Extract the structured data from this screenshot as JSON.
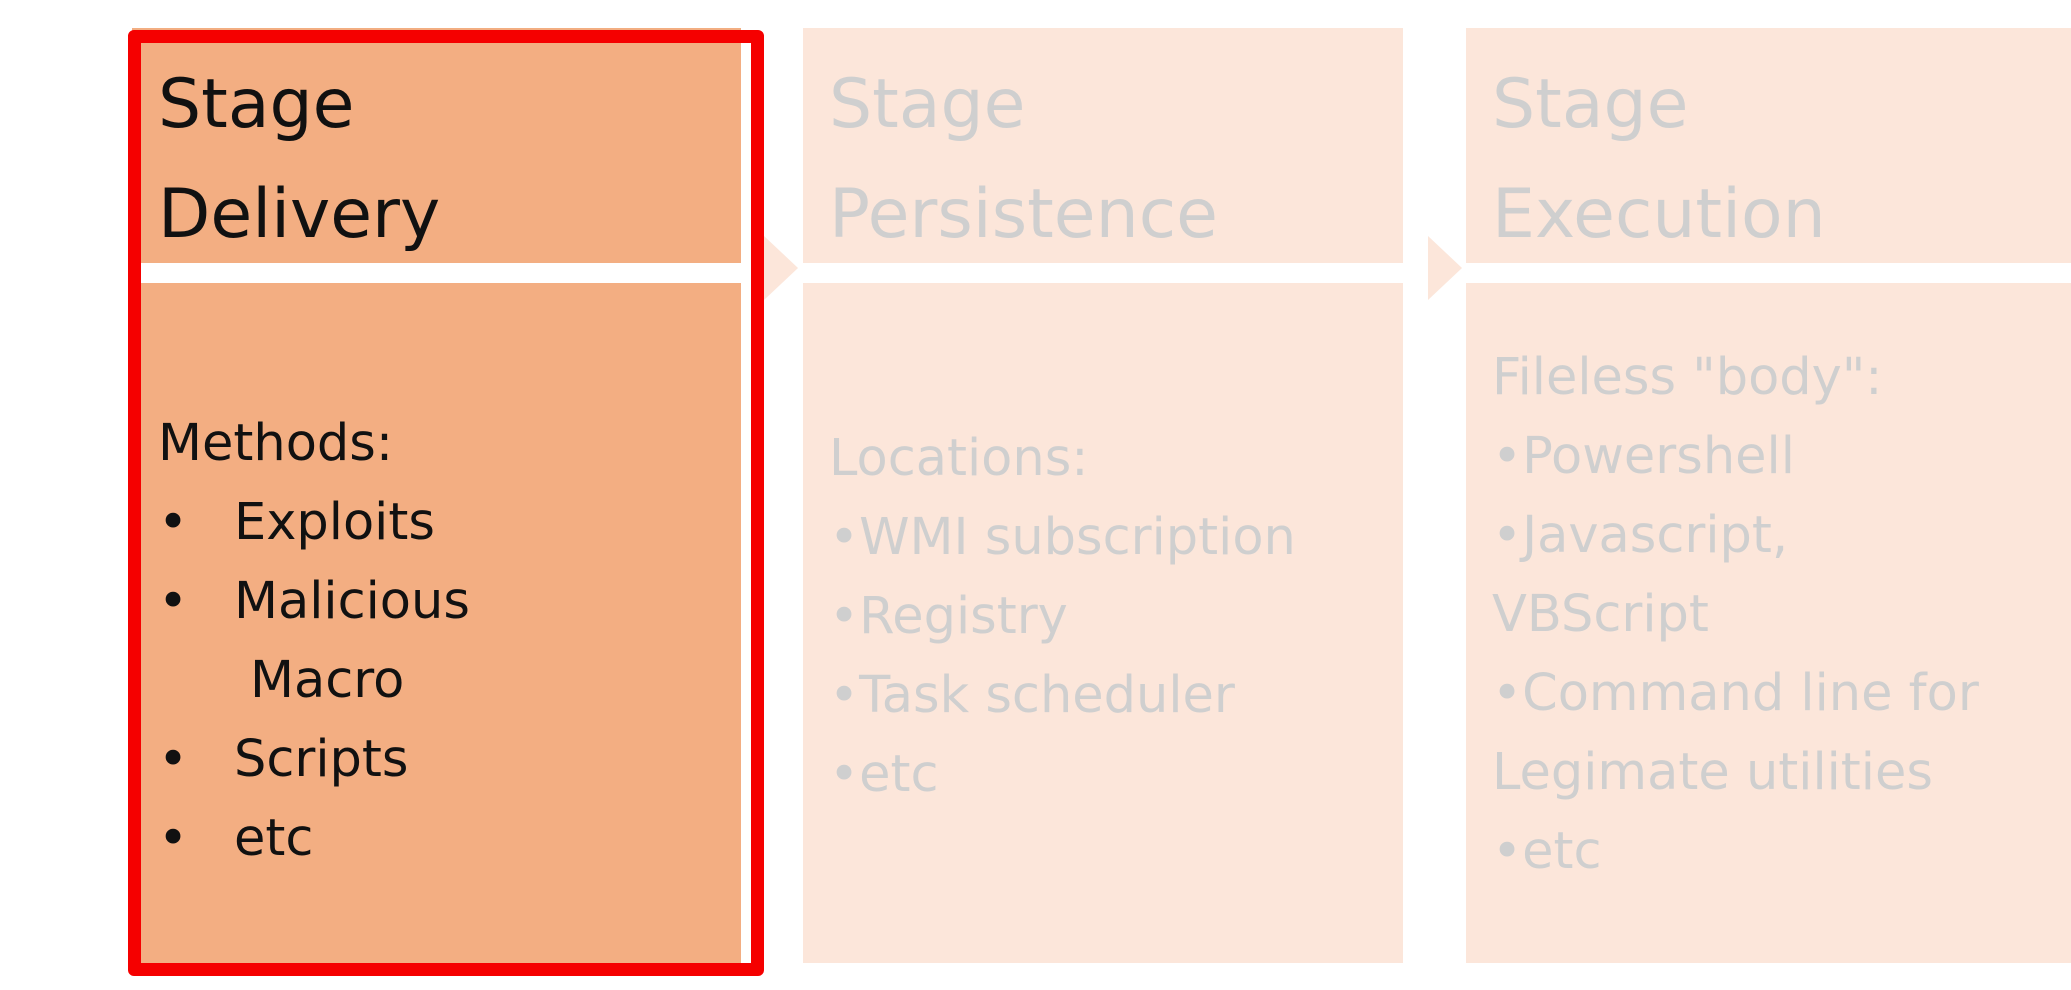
{
  "colors": {
    "active_fill": "#f3ae82",
    "faded_fill": "#fce6da",
    "highlight_border": "#f50000",
    "active_text": "#111111",
    "faded_text": "#cfcfcf"
  },
  "stages": [
    {
      "title_line1": "Stage",
      "title_line2": "Delivery",
      "heading": "Methods:",
      "items": [
        "Exploits",
        "Malicious",
        "Macro",
        "Scripts",
        "etc"
      ],
      "bullet": "•"
    },
    {
      "title_line1": "Stage",
      "title_line2": "Persistence",
      "lines": [
        "Locations:",
        "•WMI subscription",
        "•Registry",
        "•Task scheduler",
        "•etc"
      ]
    },
    {
      "title_line1": "Stage",
      "title_line2": "Execution",
      "lines": [
        "Fileless \"body\":",
        "•Powershell",
        "•Javascript,",
        "VBScript",
        "•Command line for",
        "Legimate utilities",
        "•etc"
      ]
    }
  ]
}
